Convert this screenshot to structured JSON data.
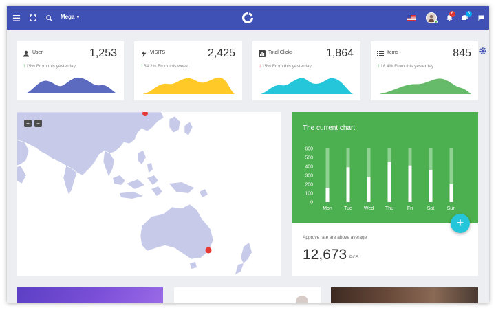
{
  "topbar": {
    "mega_label": "Mega",
    "notification_count": "6",
    "message_count": "3",
    "bg_color": "#3f51b5"
  },
  "stats": [
    {
      "title": "User",
      "icon": "user-icon",
      "value": "1,253",
      "direction": "up",
      "change": "15% From this yesterday",
      "color": "#5c6bc0"
    },
    {
      "title": "VISITS",
      "icon": "lightning-icon",
      "value": "2,425",
      "direction": "up",
      "change": "54.2% From this week",
      "color": "#ffca28"
    },
    {
      "title": "Total Clicks",
      "icon": "bar-chart-icon",
      "value": "1,864",
      "direction": "down",
      "change": "15% From this yesterday",
      "color": "#26c6da"
    },
    {
      "title": "Items",
      "icon": "list-icon",
      "value": "845",
      "direction": "up",
      "change": "18.4% From this yesterday",
      "color": "#66bb6a"
    }
  ],
  "map": {
    "zoom_in_label": "+",
    "zoom_out_label": "−"
  },
  "chart_panel": {
    "title": "The current chart",
    "fab_label": "+",
    "approve_text": "Approve rate are above average",
    "big_value": "12,673",
    "big_unit": "PCS"
  },
  "chart_data": {
    "type": "bar",
    "title": "The current chart",
    "categories": [
      "Mon",
      "Tue",
      "Wed",
      "Thu",
      "Fri",
      "Sat",
      "Sun"
    ],
    "yticks": [
      "600",
      "500",
      "400",
      "300",
      "200",
      "100",
      "0"
    ],
    "ylim": [
      0,
      600
    ],
    "series": [
      {
        "values": [
          160,
          390,
          280,
          450,
          410,
          360,
          200
        ]
      }
    ],
    "capacity": 600,
    "grid": false
  },
  "colors": {
    "bar_fill": "#ffffff",
    "bar_track": "#8fd192",
    "panel_green": "#4caf50",
    "map_land": "#c7cbe9",
    "map_marker": "#e53935"
  }
}
